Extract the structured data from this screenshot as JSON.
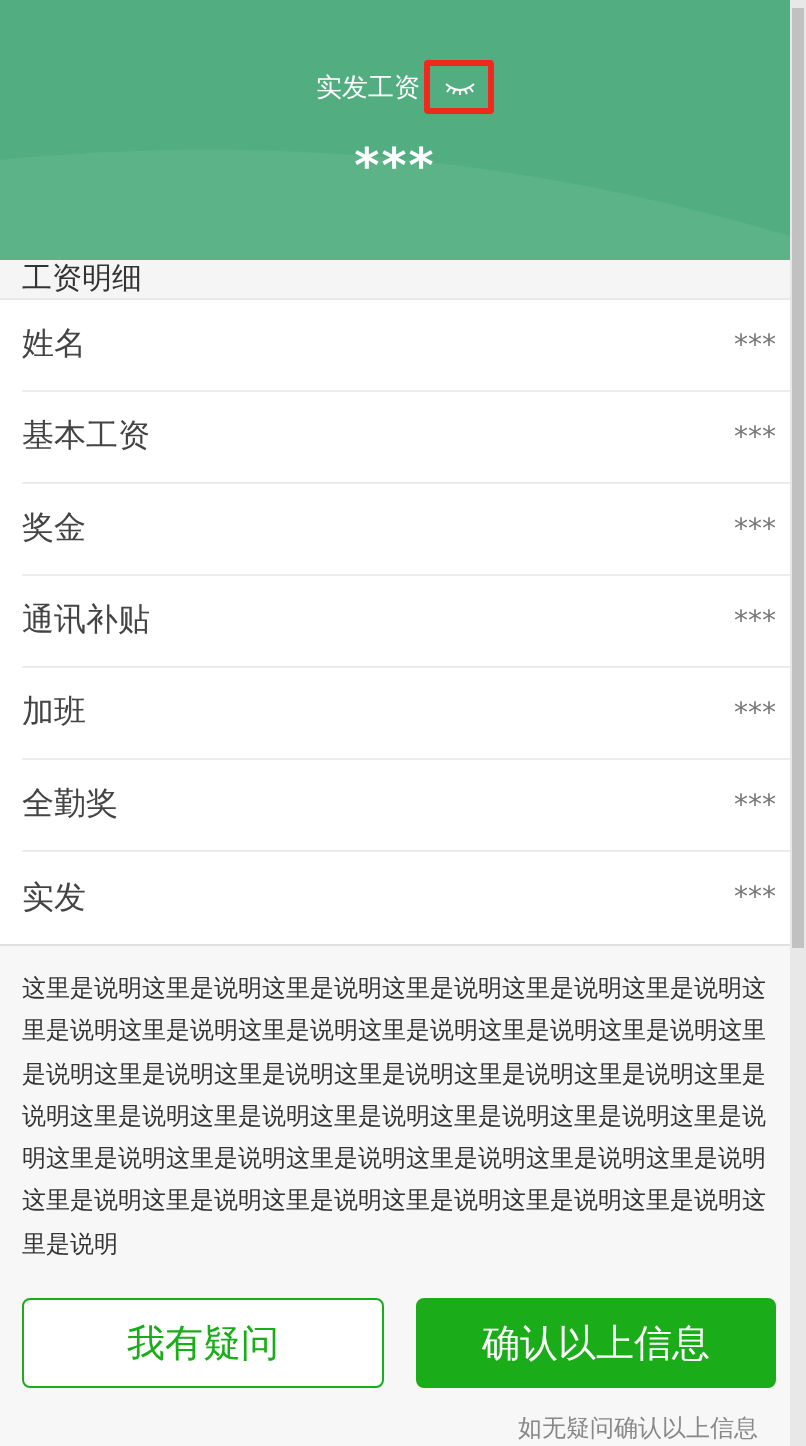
{
  "header": {
    "title": "实发工资",
    "amount": "***",
    "eye_highlighted": true
  },
  "section_title": "工资明细",
  "rows": [
    {
      "label": "姓名",
      "value": "***"
    },
    {
      "label": "基本工资",
      "value": "***"
    },
    {
      "label": "奖金",
      "value": "***"
    },
    {
      "label": "通讯补贴",
      "value": "***"
    },
    {
      "label": "加班",
      "value": "***"
    },
    {
      "label": "全勤奖",
      "value": "***"
    },
    {
      "label": "实发",
      "value": "***"
    }
  ],
  "note": "这里是说明这里是说明这里是说明这里是说明这里是说明这里是说明这里是说明这里是说明这里是说明这里是说明这里是说明这里是说明这里是说明这里是说明这里是说明这里是说明这里是说明这里是说明这里是说明这里是说明这里是说明这里是说明这里是说明这里是说明这里是说明这里是说明这里是说明这里是说明这里是说明这里是说明这里是说明这里是说明这里是说明这里是说明这里是说明这里是说明这里是说明这里是说明",
  "buttons": [
    {
      "label": "我有疑问",
      "kind": "outline"
    },
    {
      "label": "确认以上信息",
      "kind": "primary"
    }
  ],
  "footer_hint": "如无疑问确认以上信息"
}
